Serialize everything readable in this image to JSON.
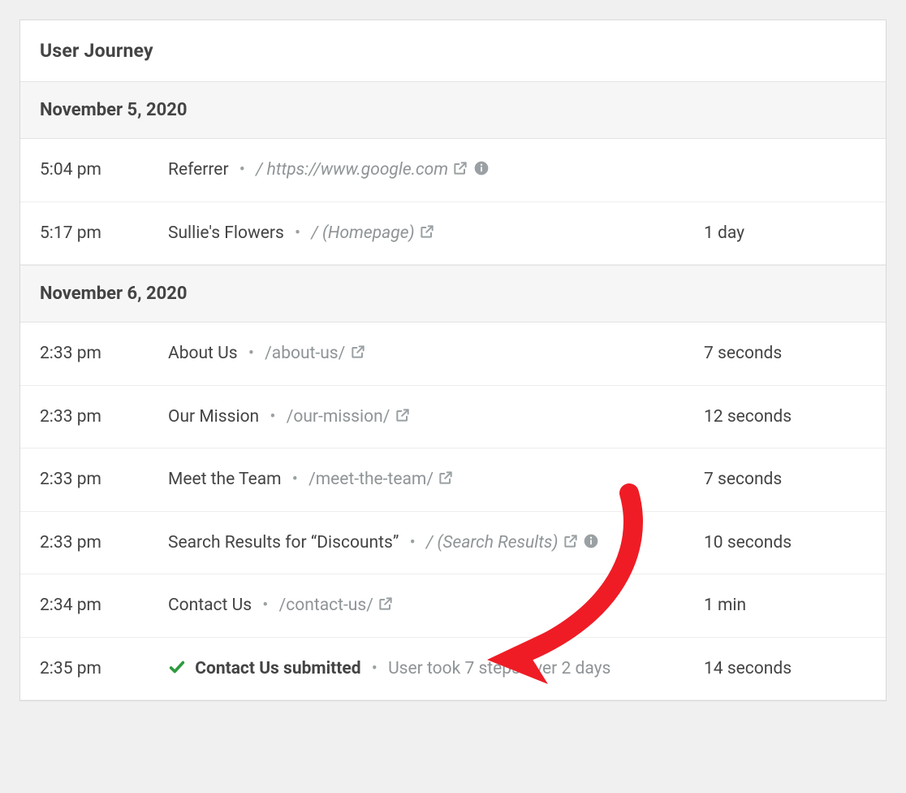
{
  "panel": {
    "title": "User Journey"
  },
  "groups": [
    {
      "date": "November 5, 2020",
      "rows": [
        {
          "time": "5:04 pm",
          "title": "Referrer",
          "pathPrefix": "/ ",
          "path": "https://www.google.com",
          "pathItalic": true,
          "ext": true,
          "info": true,
          "duration": ""
        },
        {
          "time": "5:17 pm",
          "title": "Sullie's Flowers",
          "pathPrefix": "/ ",
          "path": "(Homepage)",
          "pathItalic": true,
          "ext": true,
          "info": false,
          "duration": "1 day"
        }
      ]
    },
    {
      "date": "November 6, 2020",
      "rows": [
        {
          "time": "2:33 pm",
          "title": "About Us",
          "pathPrefix": "",
          "path": "/about-us/",
          "pathItalic": false,
          "ext": true,
          "info": false,
          "duration": "7 seconds"
        },
        {
          "time": "2:33 pm",
          "title": "Our Mission",
          "pathPrefix": "",
          "path": "/our-mission/",
          "pathItalic": false,
          "ext": true,
          "info": false,
          "duration": "12 seconds"
        },
        {
          "time": "2:33 pm",
          "title": "Meet the Team",
          "pathPrefix": "",
          "path": "/meet-the-team/",
          "pathItalic": false,
          "ext": true,
          "info": false,
          "duration": "7 seconds"
        },
        {
          "time": "2:33 pm",
          "title": "Search Results for “Discounts”",
          "pathPrefix": "/ ",
          "path": "(Search Results)",
          "pathItalic": true,
          "ext": true,
          "info": true,
          "duration": "10 seconds"
        },
        {
          "time": "2:34 pm",
          "title": "Contact Us",
          "pathPrefix": "",
          "path": "/contact-us/",
          "pathItalic": false,
          "ext": true,
          "info": false,
          "duration": "1 min"
        },
        {
          "time": "2:35 pm",
          "check": true,
          "titleBold": true,
          "title": "Contact Us submitted",
          "note": "User took 7 steps over 2 days",
          "duration": "14 seconds"
        }
      ]
    }
  ]
}
